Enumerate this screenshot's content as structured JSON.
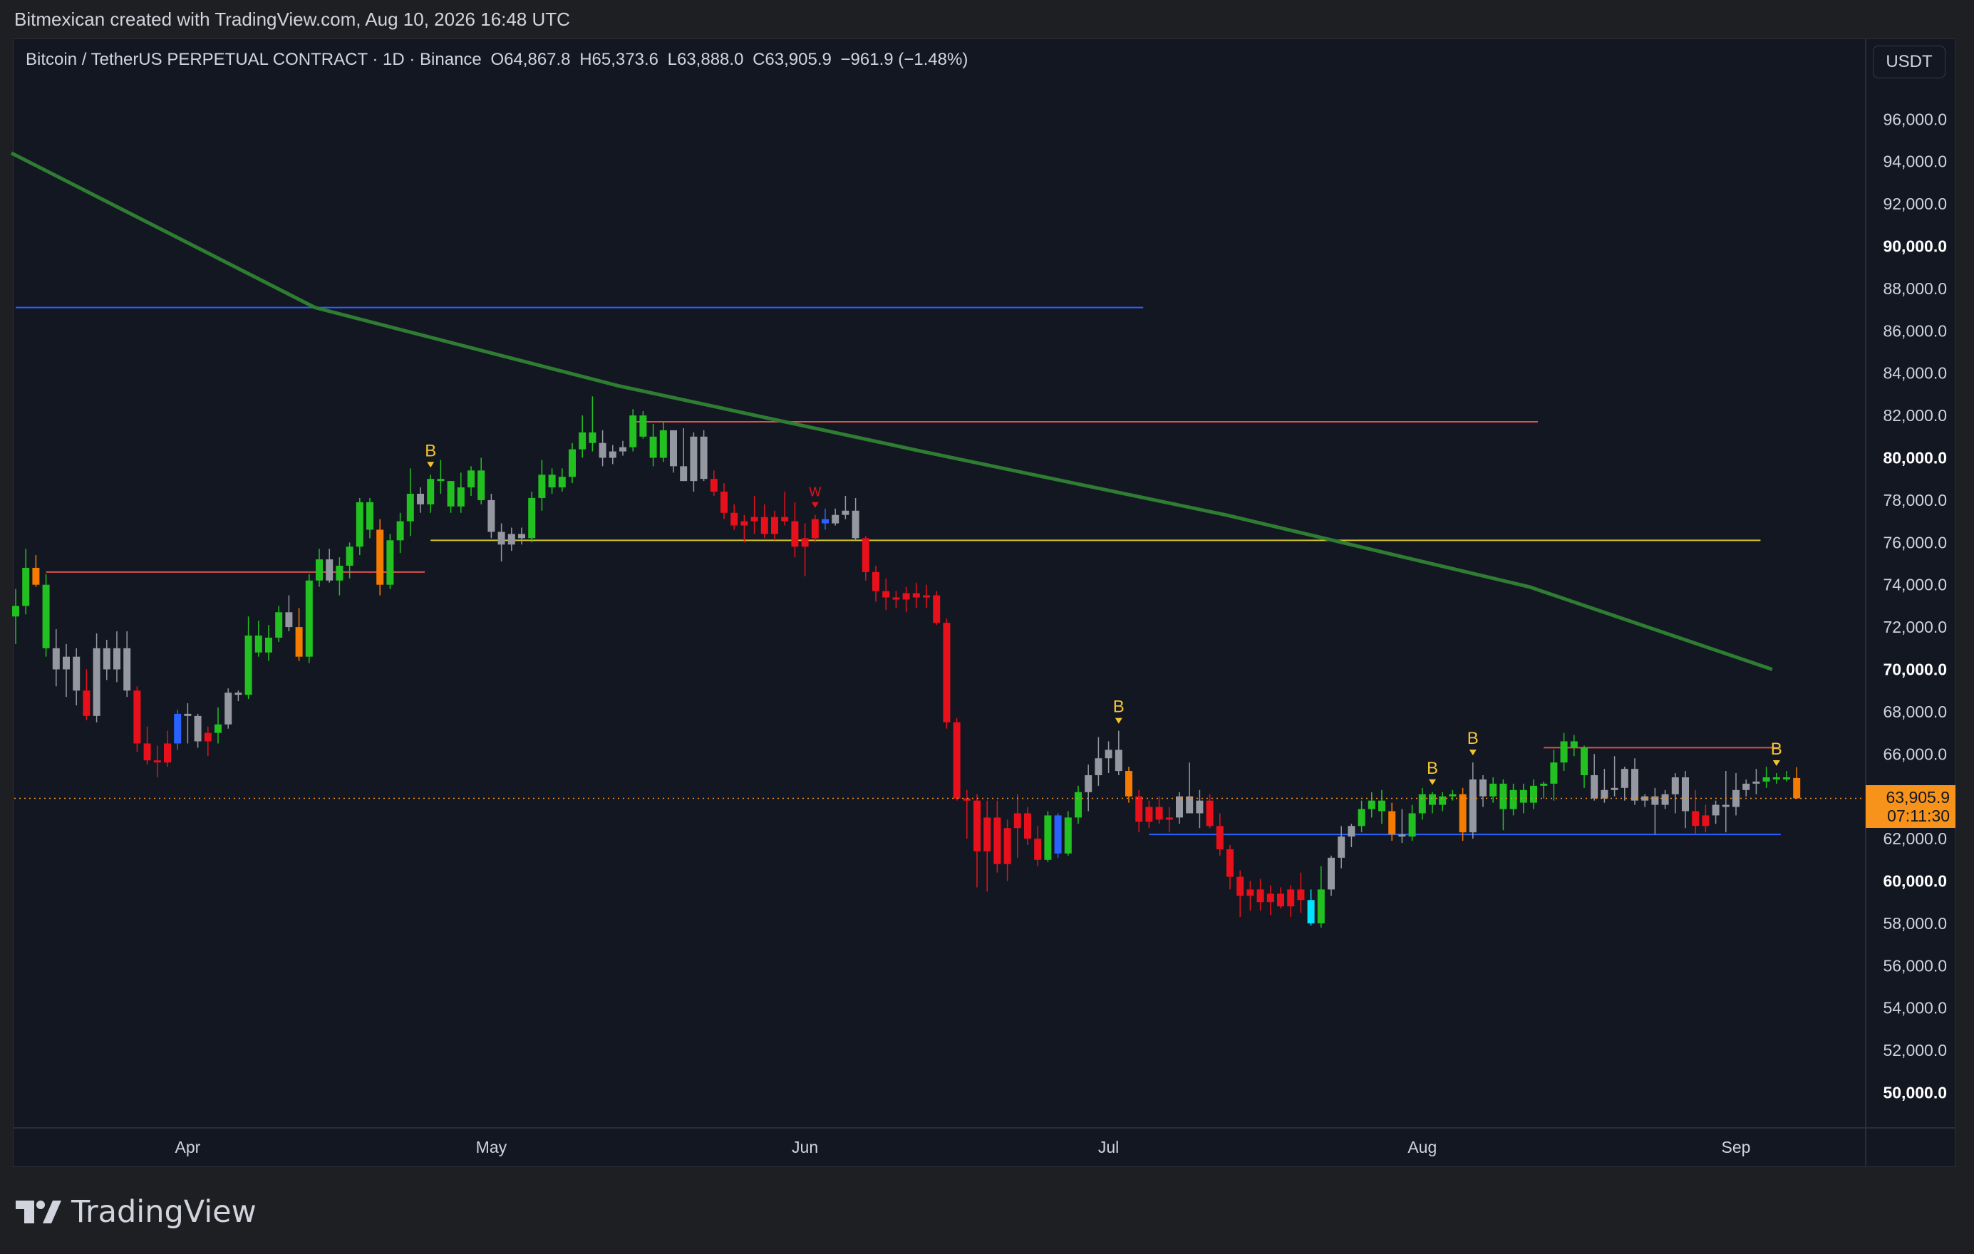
{
  "header": {
    "author_line": "Bitmexican created with TradingView.com, Aug 10, 2026 16:48 UTC"
  },
  "legend": {
    "symbol": "Bitcoin / TetherUS PERPETUAL CONTRACT · 1D · Binance",
    "open": "O64,867.8",
    "high": "H65,373.6",
    "low": "L63,888.0",
    "close": "C63,905.9",
    "change": "−961.9 (−1.48%)"
  },
  "currency_button": "USDT",
  "price_tag": {
    "price": "63,905.9",
    "countdown": "07:11:30"
  },
  "footer": {
    "logo_text": "TradingView"
  },
  "colors": {
    "background": "#131722",
    "up": "#22c121",
    "down": "#e8101a",
    "neutral": "#9598a1",
    "orange": "#f57c00",
    "blue": "#2962ff",
    "cyan": "#00e5ff",
    "moving_average": "#2e7d32",
    "signal_text": "#f4c430",
    "hline_red": "#d9534f",
    "hline_yellow": "#d4c72a",
    "hline_blue": "#3d8fd6"
  },
  "chart_data": {
    "type": "candlestick",
    "symbol": "Bitcoin / TetherUS PERPETUAL CONTRACT",
    "interval": "1D",
    "exchange": "Binance",
    "ylim": [
      48000,
      98000
    ],
    "y_ticks": [
      "96,000.0",
      "94,000.0",
      "92,000.0",
      "90,000.0",
      "88,000.0",
      "86,000.0",
      "84,000.0",
      "82,000.0",
      "80,000.0",
      "78,000.0",
      "76,000.0",
      "74,000.0",
      "72,000.0",
      "70,000.0",
      "68,000.0",
      "66,000.0",
      "64,000.0",
      "62,000.0",
      "60,000.0",
      "58,000.0",
      "56,000.0",
      "54,000.0",
      "52,000.0",
      "50,000.0"
    ],
    "bold_y_ticks": [
      "90,000.0",
      "80,000.0",
      "70,000.0",
      "60,000.0",
      "50,000.0"
    ],
    "x_ticks": [
      {
        "label": "Apr",
        "date": "2026-04-01"
      },
      {
        "label": "May",
        "date": "2026-05-01"
      },
      {
        "label": "Jun",
        "date": "2026-06-01"
      },
      {
        "label": "Jul",
        "date": "2026-07-01"
      },
      {
        "label": "Aug",
        "date": "2026-08-01"
      },
      {
        "label": "Sep",
        "date": "2026-09-01"
      }
    ],
    "first_date": "2026-03-15",
    "ohlc": [
      [
        72500,
        73800,
        71200,
        73000,
        "up"
      ],
      [
        73000,
        75700,
        72600,
        74800,
        "up"
      ],
      [
        74800,
        75400,
        73900,
        74000,
        "orange"
      ],
      [
        74000,
        74500,
        70600,
        71000,
        "up"
      ],
      [
        71000,
        71900,
        69200,
        70000,
        "neutral"
      ],
      [
        70000,
        71200,
        68700,
        70600,
        "neutral"
      ],
      [
        70600,
        71000,
        68300,
        69000,
        "neutral"
      ],
      [
        69000,
        70000,
        67600,
        67800,
        "down"
      ],
      [
        67800,
        71700,
        67500,
        71000,
        "neutral"
      ],
      [
        71000,
        71400,
        69500,
        70000,
        "neutral"
      ],
      [
        70000,
        71800,
        69400,
        71000,
        "neutral"
      ],
      [
        71000,
        71800,
        68700,
        69000,
        "neutral"
      ],
      [
        69000,
        69200,
        66100,
        66500,
        "down"
      ],
      [
        66500,
        67300,
        65500,
        65700,
        "down"
      ],
      [
        65700,
        66400,
        64900,
        65600,
        "down"
      ],
      [
        65600,
        67100,
        65400,
        66500,
        "down"
      ],
      [
        66500,
        68100,
        66200,
        67900,
        "blue"
      ],
      [
        67900,
        68400,
        66500,
        67800,
        "neutral"
      ],
      [
        67800,
        67900,
        66300,
        66600,
        "neutral"
      ],
      [
        66600,
        67300,
        65900,
        67000,
        "down"
      ],
      [
        67000,
        68200,
        66500,
        67400,
        "up"
      ],
      [
        67400,
        69100,
        67200,
        68900,
        "neutral"
      ],
      [
        68900,
        69000,
        68500,
        68800,
        "neutral"
      ],
      [
        68800,
        72500,
        68600,
        71600,
        "up"
      ],
      [
        71600,
        72300,
        70600,
        70800,
        "up"
      ],
      [
        70800,
        72100,
        70400,
        71500,
        "up"
      ],
      [
        71500,
        73000,
        71300,
        72700,
        "up"
      ],
      [
        72700,
        73500,
        71800,
        72000,
        "neutral"
      ],
      [
        72000,
        72900,
        70400,
        70600,
        "orange"
      ],
      [
        70600,
        74500,
        70300,
        74200,
        "up"
      ],
      [
        74200,
        75700,
        73900,
        75200,
        "up"
      ],
      [
        75200,
        75700,
        74100,
        74200,
        "neutral"
      ],
      [
        74200,
        75300,
        73500,
        74900,
        "up"
      ],
      [
        74900,
        76000,
        74300,
        75800,
        "up"
      ],
      [
        75800,
        78100,
        75400,
        77900,
        "up"
      ],
      [
        77900,
        78100,
        76200,
        76600,
        "up"
      ],
      [
        76600,
        77100,
        73500,
        74000,
        "orange"
      ],
      [
        74000,
        76400,
        73800,
        76100,
        "up"
      ],
      [
        76100,
        77400,
        75500,
        77000,
        "up"
      ],
      [
        77000,
        79500,
        76300,
        78300,
        "up"
      ],
      [
        78300,
        78600,
        77400,
        77800,
        "neutral"
      ],
      [
        77800,
        79200,
        77400,
        79000,
        "up"
      ],
      [
        79000,
        79900,
        78300,
        78900,
        "up"
      ],
      [
        78900,
        78900,
        77400,
        77700,
        "up"
      ],
      [
        77700,
        79300,
        77400,
        78600,
        "up"
      ],
      [
        78600,
        79600,
        78200,
        79400,
        "up"
      ],
      [
        79400,
        80000,
        77800,
        78000,
        "up"
      ],
      [
        78000,
        78300,
        76200,
        76500,
        "neutral"
      ],
      [
        76500,
        76900,
        75100,
        75900,
        "neutral"
      ],
      [
        75900,
        76700,
        75600,
        76400,
        "neutral"
      ],
      [
        76400,
        76700,
        75900,
        76200,
        "neutral"
      ],
      [
        76200,
        78400,
        76000,
        78100,
        "up"
      ],
      [
        78100,
        79900,
        77500,
        79200,
        "up"
      ],
      [
        79200,
        79500,
        78300,
        78600,
        "up"
      ],
      [
        78600,
        79500,
        78400,
        79100,
        "up"
      ],
      [
        79100,
        80700,
        78800,
        80400,
        "up"
      ],
      [
        80400,
        82000,
        80000,
        81200,
        "up"
      ],
      [
        81200,
        82900,
        80300,
        80700,
        "up"
      ],
      [
        80700,
        81300,
        79600,
        80000,
        "neutral"
      ],
      [
        80000,
        80600,
        79700,
        80300,
        "neutral"
      ],
      [
        80300,
        80800,
        80100,
        80500,
        "neutral"
      ],
      [
        80500,
        82300,
        80300,
        82000,
        "up"
      ],
      [
        82000,
        82200,
        80900,
        81000,
        "up"
      ],
      [
        81000,
        81600,
        79600,
        80000,
        "up"
      ],
      [
        80000,
        81700,
        79800,
        81300,
        "up"
      ],
      [
        81300,
        81300,
        79300,
        79600,
        "neutral"
      ],
      [
        79600,
        81400,
        78900,
        78900,
        "neutral"
      ],
      [
        78900,
        81200,
        78400,
        81000,
        "neutral"
      ],
      [
        81000,
        81300,
        78900,
        79000,
        "neutral"
      ],
      [
        79000,
        79400,
        78200,
        78400,
        "down"
      ],
      [
        78400,
        78800,
        77100,
        77400,
        "down"
      ],
      [
        77400,
        77800,
        76600,
        76800,
        "down"
      ],
      [
        76800,
        77300,
        76000,
        77000,
        "down"
      ],
      [
        77000,
        78200,
        76400,
        77200,
        "down"
      ],
      [
        77200,
        77800,
        76200,
        76400,
        "down"
      ],
      [
        76400,
        77500,
        76100,
        77200,
        "down"
      ],
      [
        77200,
        78400,
        76800,
        77000,
        "down"
      ],
      [
        77000,
        77900,
        75300,
        75800,
        "down"
      ],
      [
        75800,
        76900,
        74400,
        76200,
        "down"
      ],
      [
        76200,
        77300,
        76000,
        77100,
        "down"
      ],
      [
        77100,
        77600,
        76600,
        76900,
        "blue"
      ],
      [
        76900,
        77600,
        76800,
        77300,
        "neutral"
      ],
      [
        77300,
        78200,
        77100,
        77500,
        "neutral"
      ],
      [
        77500,
        78100,
        76100,
        76200,
        "neutral"
      ],
      [
        76200,
        76300,
        74200,
        74600,
        "down"
      ],
      [
        74600,
        74900,
        73200,
        73700,
        "down"
      ],
      [
        73700,
        74300,
        72800,
        73400,
        "down"
      ],
      [
        73400,
        73700,
        72900,
        73300,
        "down"
      ],
      [
        73300,
        73900,
        72700,
        73600,
        "down"
      ],
      [
        73600,
        74100,
        72900,
        73400,
        "down"
      ],
      [
        73400,
        74000,
        72900,
        73500,
        "down"
      ],
      [
        73500,
        73700,
        72100,
        72200,
        "down"
      ],
      [
        72200,
        72400,
        67200,
        67500,
        "down"
      ],
      [
        67500,
        67700,
        63800,
        63900,
        "down"
      ],
      [
        63900,
        64300,
        62000,
        63800,
        "down"
      ],
      [
        63800,
        64100,
        59700,
        61400,
        "down"
      ],
      [
        61400,
        63800,
        59500,
        63000,
        "down"
      ],
      [
        63000,
        63800,
        60400,
        60800,
        "down"
      ],
      [
        60800,
        62900,
        60000,
        62500,
        "down"
      ],
      [
        62500,
        64100,
        61100,
        63200,
        "down"
      ],
      [
        63200,
        63500,
        61700,
        62000,
        "down"
      ],
      [
        62000,
        62600,
        60700,
        61000,
        "down"
      ],
      [
        61000,
        63300,
        60900,
        63100,
        "up"
      ],
      [
        63100,
        63200,
        61100,
        61300,
        "blue"
      ],
      [
        61300,
        63300,
        61200,
        63000,
        "up"
      ],
      [
        63000,
        64500,
        62700,
        64200,
        "up"
      ],
      [
        64200,
        65500,
        63300,
        65000,
        "neutral"
      ],
      [
        65000,
        66800,
        64500,
        65800,
        "neutral"
      ],
      [
        65800,
        66600,
        65100,
        66200,
        "neutral"
      ],
      [
        66200,
        67100,
        65000,
        65200,
        "neutral"
      ],
      [
        65200,
        65400,
        63700,
        64000,
        "orange"
      ],
      [
        64000,
        64300,
        62300,
        62800,
        "down"
      ],
      [
        62800,
        63800,
        62500,
        63500,
        "down"
      ],
      [
        63500,
        64000,
        62700,
        62900,
        "down"
      ],
      [
        62900,
        63500,
        62300,
        63000,
        "down"
      ],
      [
        63000,
        64200,
        62700,
        64000,
        "neutral"
      ],
      [
        64000,
        65600,
        63200,
        63200,
        "neutral"
      ],
      [
        63200,
        64300,
        62500,
        63800,
        "neutral"
      ],
      [
        63800,
        64100,
        62500,
        62600,
        "down"
      ],
      [
        62600,
        63200,
        61200,
        61500,
        "down"
      ],
      [
        61500,
        61700,
        59600,
        60200,
        "down"
      ],
      [
        60200,
        60500,
        58300,
        59300,
        "down"
      ],
      [
        59300,
        60000,
        58600,
        59600,
        "down"
      ],
      [
        59600,
        60100,
        58600,
        59000,
        "down"
      ],
      [
        59000,
        59800,
        58400,
        59400,
        "down"
      ],
      [
        59400,
        59700,
        58700,
        58800,
        "down"
      ],
      [
        58800,
        59800,
        58300,
        59600,
        "down"
      ],
      [
        59600,
        60400,
        58500,
        59100,
        "down"
      ],
      [
        59100,
        59600,
        57900,
        58000,
        "cyan"
      ],
      [
        58000,
        60700,
        57800,
        59600,
        "up"
      ],
      [
        59600,
        61200,
        59300,
        61100,
        "neutral"
      ],
      [
        61100,
        62600,
        60600,
        62100,
        "neutral"
      ],
      [
        62100,
        62700,
        61600,
        62600,
        "neutral"
      ],
      [
        62600,
        63800,
        62300,
        63400,
        "up"
      ],
      [
        63400,
        64200,
        63000,
        63800,
        "up"
      ],
      [
        63800,
        64300,
        62700,
        63300,
        "up"
      ],
      [
        63300,
        63700,
        61900,
        62200,
        "orange"
      ],
      [
        62200,
        63400,
        61800,
        62100,
        "neutral"
      ],
      [
        62100,
        63600,
        61900,
        63200,
        "up"
      ],
      [
        63200,
        64400,
        62900,
        64100,
        "up"
      ],
      [
        64100,
        64200,
        63200,
        63600,
        "up"
      ],
      [
        63600,
        64200,
        63300,
        64000,
        "up"
      ],
      [
        64000,
        64300,
        63800,
        64100,
        "up"
      ],
      [
        64100,
        64400,
        61900,
        62300,
        "orange"
      ],
      [
        62300,
        65600,
        62000,
        64800,
        "neutral"
      ],
      [
        64800,
        65000,
        63500,
        64000,
        "neutral"
      ],
      [
        64000,
        64900,
        63700,
        64600,
        "up"
      ],
      [
        64600,
        64800,
        62400,
        63400,
        "up"
      ],
      [
        63400,
        64600,
        63100,
        64300,
        "up"
      ],
      [
        64300,
        64600,
        63200,
        63700,
        "up"
      ],
      [
        63700,
        64800,
        63400,
        64500,
        "up"
      ],
      [
        64500,
        64700,
        63900,
        64600,
        "up"
      ],
      [
        64600,
        66200,
        63800,
        65600,
        "up"
      ],
      [
        65600,
        67000,
        65200,
        66600,
        "up"
      ],
      [
        66600,
        66900,
        65900,
        66300,
        "up"
      ],
      [
        66300,
        66400,
        64400,
        65000,
        "up"
      ],
      [
        65000,
        66000,
        63800,
        63900,
        "neutral"
      ],
      [
        63900,
        65300,
        63700,
        64300,
        "neutral"
      ],
      [
        64300,
        65900,
        64000,
        64400,
        "neutral"
      ],
      [
        64400,
        65400,
        63800,
        65300,
        "neutral"
      ],
      [
        65300,
        65800,
        63600,
        63800,
        "neutral"
      ],
      [
        63800,
        64100,
        63500,
        64000,
        "neutral"
      ],
      [
        64000,
        64400,
        62200,
        63600,
        "neutral"
      ],
      [
        63600,
        64300,
        63400,
        64100,
        "neutral"
      ],
      [
        64100,
        65100,
        63200,
        64900,
        "neutral"
      ],
      [
        64900,
        65200,
        62500,
        63300,
        "neutral"
      ],
      [
        63300,
        64300,
        62200,
        62600,
        "down"
      ],
      [
        62600,
        63600,
        62300,
        63100,
        "down"
      ],
      [
        63100,
        63800,
        62700,
        63600,
        "neutral"
      ],
      [
        63600,
        65200,
        62300,
        63500,
        "neutral"
      ],
      [
        63500,
        65100,
        63100,
        64300,
        "neutral"
      ],
      [
        64300,
        64800,
        64000,
        64600,
        "neutral"
      ],
      [
        64600,
        65300,
        64100,
        64700,
        "neutral"
      ],
      [
        64700,
        65400,
        64400,
        64900,
        "up"
      ],
      [
        64900,
        65100,
        64600,
        64800,
        "up"
      ],
      [
        64800,
        65200,
        64700,
        64900,
        "up"
      ],
      [
        64867.8,
        65373.6,
        63888.0,
        63905.9,
        "orange"
      ]
    ],
    "moving_average": [
      [
        0,
        94400
      ],
      [
        30,
        87100
      ],
      [
        60,
        83400
      ],
      [
        90,
        80300
      ],
      [
        120,
        77300
      ],
      [
        150,
        73900
      ],
      [
        174,
        70000
      ]
    ],
    "horizontal_levels": [
      {
        "price": 87100,
        "from": 0,
        "to": 111,
        "color": "blue"
      },
      {
        "price": 81700,
        "from": 61,
        "to": 150,
        "color": "red"
      },
      {
        "price": 76100,
        "from": 41,
        "to": 172,
        "color": "yellow"
      },
      {
        "price": 74600,
        "from": 3,
        "to": 40,
        "color": "red"
      },
      {
        "price": 66300,
        "from": 151,
        "to": 174,
        "color": "red"
      },
      {
        "price": 62200,
        "from": 112,
        "to": 174,
        "color": "blue"
      }
    ],
    "signals": [
      {
        "index": 41,
        "label": "B"
      },
      {
        "index": 109,
        "label": "B"
      },
      {
        "index": 140,
        "label": "B"
      },
      {
        "index": 144,
        "label": "B"
      },
      {
        "index": 174,
        "label": "B"
      },
      {
        "index": 79,
        "label": "W"
      }
    ],
    "last_price_line": 63905.9
  }
}
